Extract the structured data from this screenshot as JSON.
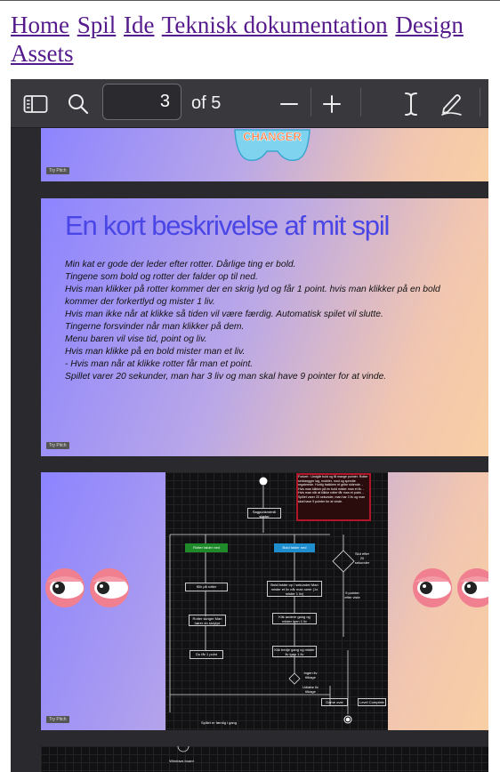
{
  "nav": {
    "links": [
      "Home",
      "Spil",
      "Ide",
      "Teknisk dokumentation",
      "Design",
      "Assets"
    ]
  },
  "toolbar": {
    "page_current": "3",
    "page_total_label": "of 5"
  },
  "icons": [
    "sidebar-toggle-icon",
    "search-icon",
    "zoom-out-icon",
    "zoom-in-icon",
    "text-select-icon",
    "draw-icon"
  ],
  "slides": {
    "slide1": {
      "logo_text": "CHANGER",
      "badge": "Try Pitch"
    },
    "slide2": {
      "title": "En kort beskrivelse af mit spil",
      "lines": [
        "Min kat er gode der leder efter rotter. Dårlige ting er bold.",
        "Tingene som bold og rotter der falder op til ned.",
        "Hvis man klikker på rotter kommer der en skrig lyd og får 1 point. hvis man klikker på en bold",
        "kommer der forkertlyd og mister 1 liv.",
        "Hvis man ikke når at klikke så tiden vil være færdig. Automatisk spilet vil slutte.",
        "Tingerne forsvinder når man klikker på dem.",
        "Menu baren vil vise tid, point og liv.",
        "Hvis man klikke på en bold mister man et liv.",
        "- Hvis man når at klikke rotter får man et point.",
        "Spillet varer 20 sekunder, man har 3 liv og man skal have 9 pointer for at vinde."
      ],
      "badge": "Try Pitch"
    },
    "slide3": {
      "badge": "Try Pitch",
      "nodes": {
        "start": "Sagpunkmenill starter",
        "rotter": "Rotter falder ned",
        "bold": "Bold falder ned",
        "klik_rotter": "Klik på rotter",
        "klik_bold": "Bold falder op / sekunder Man mister et liv når man rører (1x mister 1 liv)",
        "rotter_skrige": "Rotter skriger Man hører en skrylyd",
        "fork": "Klik andere gang og mister igen 1 liv",
        "du_far": "Du får 1 point",
        "gang3": "Klik tredje gang og mister liv igen 1 liv",
        "game_over": "Game over",
        "level_complete": "Level Complete",
        "slut": "Spillet er færdig i gang",
        "timer": "Slut efter 20 sekunder",
        "pointer": "9 pointer efter viste",
        "ingen": "Ingen liv tilbage",
        "udlob": "Udløbe liv tilbage",
        "info": "Forkert : Undgår bold og få mange pointer. Rotter selvlaegger lag, mobiler, mod og spredte regalerede. Hurtig fastklem et gribe sidende. - Hvis man klikker på en bold mister man et liv. - Hvis man når at klikke rotter får man et point. - Spillet varer 20 sekunder, man har 3 liv og man skal have 9 pointer for at vinde."
      }
    },
    "slide4": {
      "label": "Windows board"
    }
  },
  "colors": {
    "viewer_bg": "#2a2a2e",
    "toolbar_bg": "#38383d",
    "link": "#551a8b",
    "slide_title": "#4a46e6"
  }
}
